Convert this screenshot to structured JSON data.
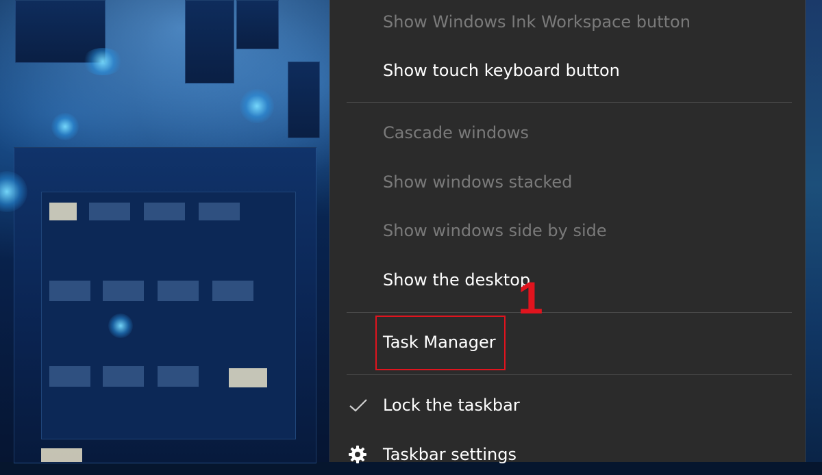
{
  "menu": {
    "items": [
      {
        "label": "Show Windows Ink Workspace button",
        "enabled": false,
        "checked": false,
        "icon": ""
      },
      {
        "label": "Show touch keyboard button",
        "enabled": true,
        "checked": false,
        "icon": ""
      },
      {
        "label": "Cascade windows",
        "enabled": false,
        "checked": false,
        "icon": ""
      },
      {
        "label": "Show windows stacked",
        "enabled": false,
        "checked": false,
        "icon": ""
      },
      {
        "label": "Show windows side by side",
        "enabled": false,
        "checked": false,
        "icon": ""
      },
      {
        "label": "Show the desktop",
        "enabled": true,
        "checked": false,
        "icon": ""
      },
      {
        "label": "Task Manager",
        "enabled": true,
        "checked": false,
        "icon": ""
      },
      {
        "label": "Lock the taskbar",
        "enabled": true,
        "checked": true,
        "icon": "check-icon"
      },
      {
        "label": "Taskbar settings",
        "enabled": true,
        "checked": false,
        "icon": "gear-icon"
      }
    ]
  },
  "annotation": {
    "step_number": "1",
    "highlight_target": "Task Manager",
    "color": "#e0141e"
  },
  "colors": {
    "menu_background": "#2b2b2b",
    "enabled_text": "#ffffff",
    "disabled_text": "#7a7a7a",
    "separator": "#4a4a4a"
  }
}
